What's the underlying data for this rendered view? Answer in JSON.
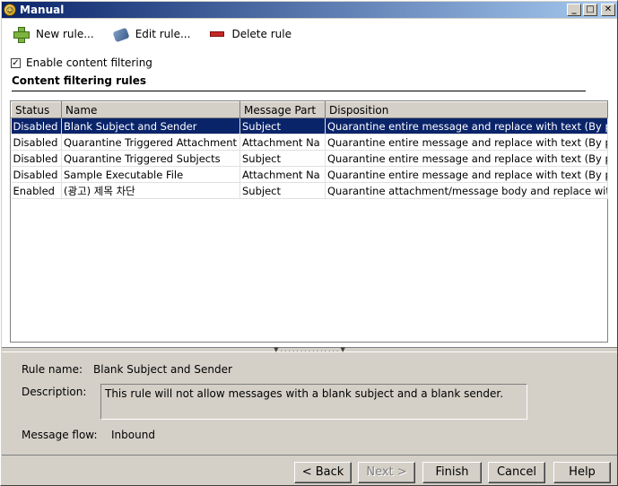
{
  "window": {
    "title": "Manual"
  },
  "toolbar": {
    "new_label": "New rule...",
    "edit_label": "Edit rule...",
    "delete_label": "Delete rule"
  },
  "filter": {
    "enable_label": "Enable content filtering",
    "checked": true
  },
  "section": {
    "title": "Content filtering rules"
  },
  "table": {
    "columns": [
      "Status",
      "Name",
      "Message Part",
      "Disposition"
    ],
    "rows": [
      {
        "status": "Disabled",
        "name": "Blank Subject and Sender",
        "part": "Subject",
        "disposition": "Quarantine entire message and replace with text (By par",
        "selected": true
      },
      {
        "status": "Disabled",
        "name": "Quarantine Triggered Attachment",
        "part": "Attachment Na",
        "disposition": "Quarantine entire message and replace with text (By par",
        "selected": false
      },
      {
        "status": "Disabled",
        "name": "Quarantine Triggered Subjects",
        "part": "Subject",
        "disposition": "Quarantine entire message and replace with text (By par",
        "selected": false
      },
      {
        "status": "Disabled",
        "name": "Sample Executable File",
        "part": "Attachment Na",
        "disposition": "Quarantine entire message and replace with text (By par",
        "selected": false
      },
      {
        "status": "Enabled",
        "name": "(광고) 제목 차단",
        "part": "Subject",
        "disposition": "Quarantine attachment/message body and replace with",
        "selected": false
      }
    ]
  },
  "details": {
    "rule_name_label": "Rule name:",
    "rule_name_value": "Blank Subject and Sender",
    "description_label": "Description:",
    "description_value": "This rule will not allow messages with a blank subject and a blank sender.",
    "flow_label": "Message flow:",
    "flow_value": "Inbound"
  },
  "buttons": {
    "back": "< Back",
    "next": "Next >",
    "finish": "Finish",
    "cancel": "Cancel",
    "help": "Help"
  }
}
